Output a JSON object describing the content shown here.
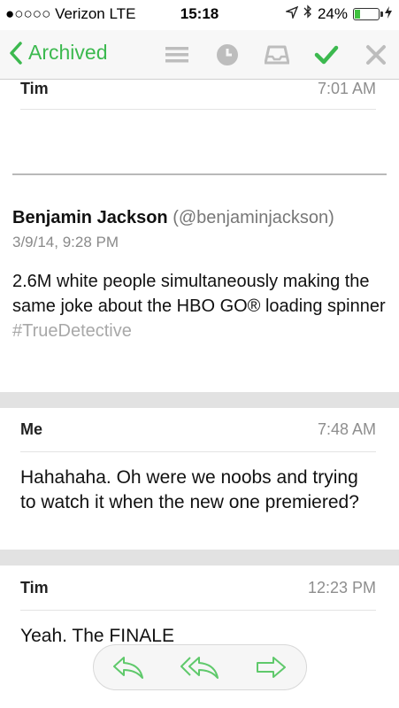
{
  "status": {
    "carrier": "●○○○○ Verizon  LTE",
    "time": "15:18",
    "battery": "24%",
    "battery_level": 0.24
  },
  "navbar": {
    "back_label": "Archived",
    "icons": [
      "menu-icon",
      "clock-icon",
      "tray-icon",
      "check-icon",
      "close-icon"
    ],
    "accent": "#3cb94f"
  },
  "messages": [
    {
      "sender": "Tim",
      "time": "7:01 AM"
    },
    {
      "sender": "Me",
      "time": "7:48 AM",
      "text": "Hahahaha. Oh were we noobs and trying to watch it when the new one premiered?"
    },
    {
      "sender": "Tim",
      "time": "12:23 PM",
      "text": "Yeah. The FINALE"
    }
  ],
  "quote": {
    "author": "Benjamin Jackson",
    "handle": "(@benjaminjackson)",
    "date": "3/9/14, 9:28 PM",
    "text": "2.6M white people simultaneously making the same joke about the HBO GO® loading spinner",
    "hashtag": "#TrueDetective"
  },
  "toolbar": {
    "icons": [
      "reply-icon",
      "reply-all-icon",
      "forward-icon"
    ]
  }
}
